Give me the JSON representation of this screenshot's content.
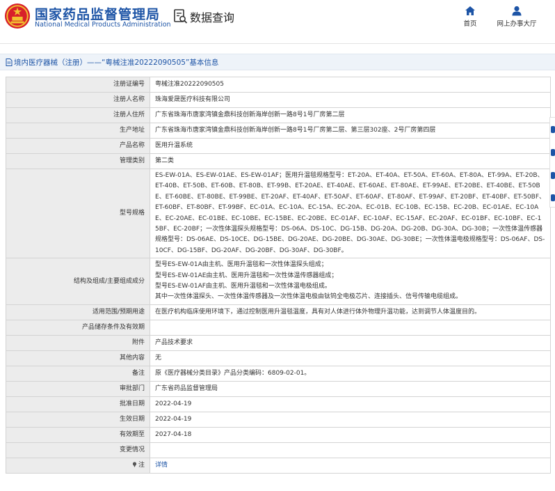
{
  "header": {
    "brand_cn": "国家药品监督管理局",
    "brand_en": "National Medical Products Administration",
    "query_title": "数据查询",
    "nav": [
      {
        "label": "首页",
        "icon": "home-icon"
      },
      {
        "label": "网上办事大厅",
        "icon": "user-icon"
      }
    ]
  },
  "title_bar": {
    "text": "境内医疗器械（注册）——“粤械注准20222090505”基本信息"
  },
  "colors": {
    "brand_blue": "#1d54a6",
    "label_bg": "#ececec",
    "title_bg": "#eef3f9",
    "logo_red": "#d8202a"
  },
  "rows": [
    {
      "label": "注册证编号",
      "value": "粤械注准20222090505"
    },
    {
      "label": "注册人名称",
      "value": "珠海爱晟医疗科技有限公司"
    },
    {
      "label": "注册人住所",
      "value": "广东省珠海市唐家湾镇金鼎科技创新海岸创新一路8号1号厂房第二层"
    },
    {
      "label": "生产地址",
      "value": "广东省珠海市唐家湾镇金鼎科技创新海岸创新一路8号1号厂房第二层、第三层302座、2号厂房第四层"
    },
    {
      "label": "产品名称",
      "value": "医用升温系统"
    },
    {
      "label": "管理类别",
      "value": "第二类"
    },
    {
      "label": "型号规格",
      "value": "ES-EW-01A、ES-EW-01AE、ES-EW-01AF；医用升温毯规格型号：ET-20A、ET-40A、ET-50A、ET-60A、ET-80A、ET-99A、ET-20B、ET-40B、ET-50B、ET-60B、ET-80B、ET-99B、ET-20AE、ET-40AE、ET-60AE、ET-80AE、ET-99AE、ET-20BE、ET-40BE、ET-50BE、ET-60BE、ET-80BE、ET-99BE、ET-20AF、ET-40AF、ET-50AF、ET-60AF、ET-80AF、ET-99AF、ET-20BF、ET-40BF、ET-50BF、ET-60BF、ET-80BF、ET-99BF、EC-01A、EC-10A、EC-15A、EC-20A、EC-01B、EC-10B、EC-15B、EC-20B、EC-01AE、EC-10AE、EC-20AE、EC-01BE、EC-10BE、EC-15BE、EC-20BE、EC-01AF、EC-10AF、EC-15AF、EC-20AF、EC-01BF、EC-10BF、EC-15BF、EC-20BF；一次性体温探头规格型号：DS-06A、DS-10C、DG-15B、DG-20A、DG-20B、DG-30A、DG-30B；一次性体温传感器规格型号：DS-06AE、DS-10CE、DG-15BE、DG-20AE、DG-20BE、DG-30AE、DG-30BE；一次性体温电极规格型号：DS-06AF、DS-10CF、DG-15BF、DG-20AF、DG-20BF、DG-30AF、DG-30BF。"
    },
    {
      "label": "结构及组成/主要组成成分",
      "lines": [
        "型号ES-EW-01A由主机、医用升温毯和一次性体温探头组成；",
        "型号ES-EW-01AE由主机、医用升温毯和一次性体温传感器组成；",
        "型号ES-EW-01AF由主机、医用升温毯和一次性体温电极组成。",
        "其中一次性体温探头、一次性体温传感器及一次性体温电极由钛钨全电极芯片、连接插头、信号传输电缆组成。"
      ]
    },
    {
      "label": "适用范围/预期用途",
      "value": "在医疗机构临床使用环境下，通过控制医用升温毯温度，具有对人体进行体外物理升温功能，达到调节人体温度目的。"
    },
    {
      "label": "产品储存条件及有效期",
      "value": ""
    },
    {
      "label": "附件",
      "value": "产品技术要求"
    },
    {
      "label": "其他内容",
      "value": "无"
    },
    {
      "label": "备注",
      "value": "原《医疗器械分类目录》产品分类编码：6809-02-01。"
    },
    {
      "label": "审批部门",
      "value": "广东省药品监督管理局"
    },
    {
      "label": "批准日期",
      "value": "2022-04-19"
    },
    {
      "label": "生效日期",
      "value": "2022-04-19"
    },
    {
      "label": "有效期至",
      "value": "2027-04-18"
    },
    {
      "label": "变更情况",
      "value": ""
    },
    {
      "label": "注",
      "value": "详情",
      "icon": "pin-icon"
    }
  ]
}
